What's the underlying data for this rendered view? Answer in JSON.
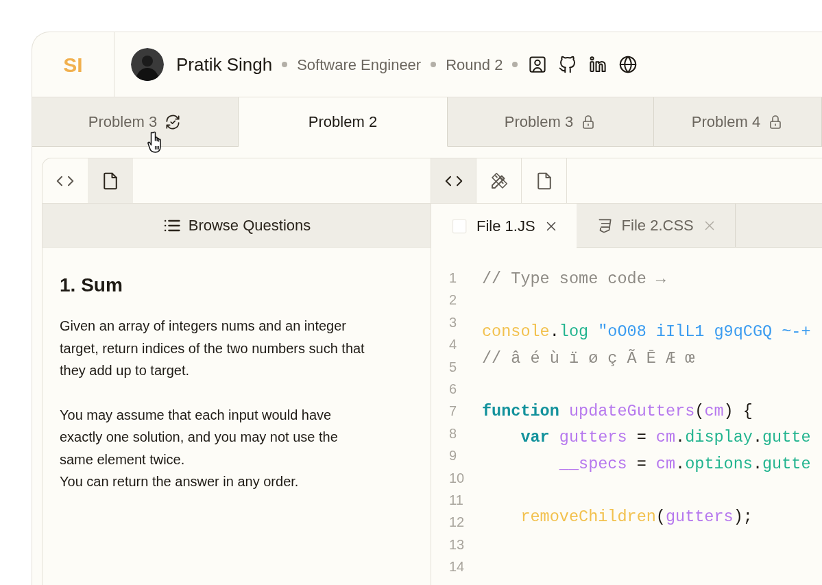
{
  "header": {
    "logo": "SI",
    "name": "Pratik Singh",
    "details": [
      "Software Engineer",
      "Round 2"
    ]
  },
  "problem_tabs": [
    {
      "label": "Problem 3",
      "selected": false,
      "locked": false,
      "retry": true,
      "hovered": true
    },
    {
      "label": "Problem 2",
      "selected": true,
      "locked": false,
      "retry": false,
      "hovered": false
    },
    {
      "label": "Problem 3",
      "selected": false,
      "locked": true,
      "retry": false,
      "hovered": false
    },
    {
      "label": "Problem 4",
      "selected": false,
      "locked": true,
      "retry": false,
      "hovered": false
    }
  ],
  "left_pane": {
    "tools": [
      {
        "kind": "code",
        "selected": false
      },
      {
        "kind": "file",
        "selected": true
      }
    ],
    "browse_button": "Browse Questions",
    "question": {
      "title": "1. Sum",
      "paragraphs": [
        {
          "lines": [
            "Given an array of integers nums and an integer target, return indices of the two numbers such that they add up to target."
          ]
        },
        {
          "lines": [
            "You may assume that each input would have exactly one solution, and you may not use the same element twice.",
            "You can return the answer in any order."
          ]
        }
      ]
    }
  },
  "right_pane": {
    "tools": [
      {
        "kind": "code",
        "selected": true
      },
      {
        "kind": "draw",
        "selected": false
      },
      {
        "kind": "file",
        "selected": false
      }
    ],
    "file_tabs": [
      {
        "label": "File 1.JS",
        "kind": "js",
        "selected": true
      },
      {
        "label": "File 2.CSS",
        "kind": "css",
        "selected": false
      }
    ],
    "line_numbers": [
      "1",
      "2",
      "3",
      "4",
      "5",
      "6",
      "7",
      "8",
      "9",
      "10",
      "11",
      "12",
      "13",
      "14"
    ],
    "code_lines": [
      {
        "tokens": [
          {
            "text": "// Type some code →",
            "kind": "comment"
          }
        ]
      },
      {
        "blank": true
      },
      {
        "tokens": [
          {
            "text": "console",
            "kind": "object"
          },
          {
            "text": ".",
            "kind": "plain"
          },
          {
            "text": "log",
            "kind": "property"
          },
          {
            "text": " \"oO08 iIlL1 g9qCGQ ~-+",
            "kind": "string"
          }
        ]
      },
      {
        "tokens": [
          {
            "text": "// â é ù ï ø ç Ã Ē Æ œ",
            "kind": "comment"
          }
        ]
      },
      {
        "blank": true
      },
      {
        "tokens": [
          {
            "text": "function",
            "kind": "keyword"
          },
          {
            "text": " updateGutters",
            "kind": "variable"
          },
          {
            "text": "(",
            "kind": "plain"
          },
          {
            "text": "cm",
            "kind": "variable"
          },
          {
            "text": ") {",
            "kind": "plain"
          }
        ]
      },
      {
        "tokens": [
          {
            "text": "    var",
            "kind": "keyword"
          },
          {
            "text": " gutters",
            "kind": "variable"
          },
          {
            "text": " = ",
            "kind": "plain"
          },
          {
            "text": "cm",
            "kind": "variable"
          },
          {
            "text": ".",
            "kind": "plain"
          },
          {
            "text": "display",
            "kind": "property"
          },
          {
            "text": ".",
            "kind": "plain"
          },
          {
            "text": "gutte",
            "kind": "property"
          }
        ]
      },
      {
        "tokens": [
          {
            "text": "        __specs",
            "kind": "variable"
          },
          {
            "text": " = ",
            "kind": "plain"
          },
          {
            "text": "cm",
            "kind": "variable"
          },
          {
            "text": ".",
            "kind": "plain"
          },
          {
            "text": "options",
            "kind": "property"
          },
          {
            "text": ".",
            "kind": "plain"
          },
          {
            "text": "gutte",
            "kind": "property"
          }
        ]
      },
      {
        "blank": true
      },
      {
        "tokens": [
          {
            "text": "    removeChildren",
            "kind": "object"
          },
          {
            "text": "(",
            "kind": "plain"
          },
          {
            "text": "gutters",
            "kind": "variable"
          },
          {
            "text": ");",
            "kind": "plain"
          }
        ]
      },
      {
        "blank": true
      }
    ]
  }
}
